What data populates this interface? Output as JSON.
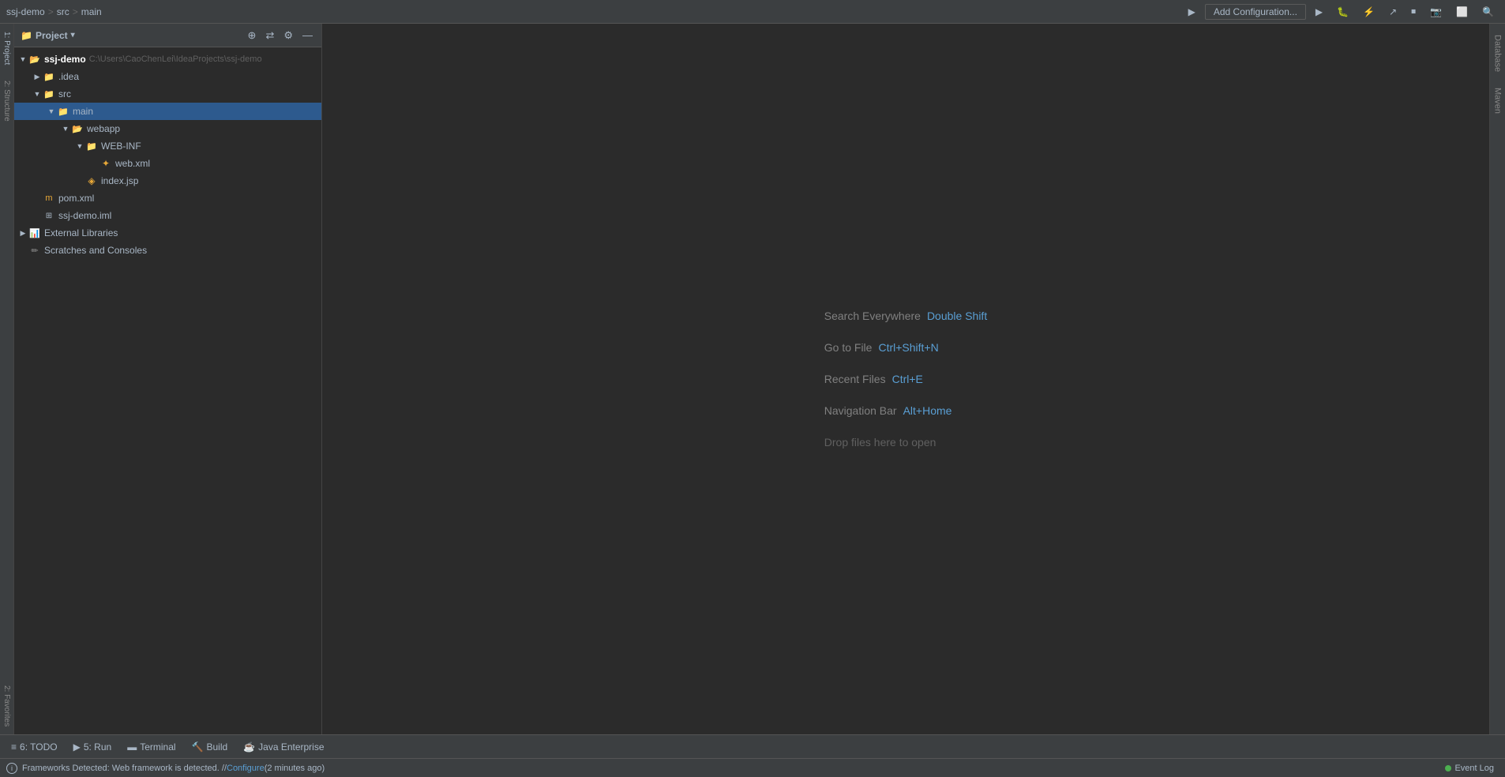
{
  "titlebar": {
    "breadcrumb": [
      "ssj-demo",
      "src",
      "main"
    ],
    "seps": [
      ">",
      ">"
    ],
    "add_config_label": "Add Configuration...",
    "toolbar_buttons": [
      "▶",
      "⏸",
      "🔄",
      "↩",
      "⏹",
      "📷",
      "⬜",
      "🔍"
    ]
  },
  "project_panel": {
    "title": "Project",
    "header_icons": [
      "⊕",
      "⇄",
      "⚙",
      "—"
    ],
    "tree": [
      {
        "id": "ssj-demo-root",
        "label": "ssj-demo",
        "path": "C:\\Users\\CaoChenLei\\IdeaProjects\\ssj-demo",
        "type": "root",
        "indent": 0,
        "arrow": "▼",
        "icon_class": "icon-folder-orange"
      },
      {
        "id": "idea",
        "label": ".idea",
        "type": "folder",
        "indent": 1,
        "arrow": "▶",
        "icon_class": "icon-folder"
      },
      {
        "id": "src",
        "label": "src",
        "type": "src-folder",
        "indent": 1,
        "arrow": "▼",
        "icon_class": "icon-folder-src"
      },
      {
        "id": "main",
        "label": "main",
        "type": "folder",
        "indent": 2,
        "arrow": "▼",
        "icon_class": "icon-folder-blue",
        "selected": true
      },
      {
        "id": "webapp",
        "label": "webapp",
        "type": "folder",
        "indent": 3,
        "arrow": "▼",
        "icon_class": "icon-folder-orange"
      },
      {
        "id": "webinf",
        "label": "WEB-INF",
        "type": "folder",
        "indent": 4,
        "arrow": "▼",
        "icon_class": "icon-folder"
      },
      {
        "id": "webxml",
        "label": "web.xml",
        "type": "xml",
        "indent": 5,
        "arrow": "",
        "icon_class": "icon-file-xml"
      },
      {
        "id": "indexjsp",
        "label": "index.jsp",
        "type": "jsp",
        "indent": 4,
        "arrow": "",
        "icon_class": "icon-file-jsp"
      },
      {
        "id": "pomxml",
        "label": "pom.xml",
        "type": "pom",
        "indent": 0,
        "arrow": "",
        "icon_class": "icon-file-pom"
      },
      {
        "id": "ssj-demo-iml",
        "label": "ssj-demo.iml",
        "type": "iml",
        "indent": 0,
        "arrow": "",
        "icon_class": "icon-file-iml"
      },
      {
        "id": "ext-libs",
        "label": "External Libraries",
        "type": "ext-lib",
        "indent": 0,
        "arrow": "▶",
        "icon_class": "icon-ext-lib"
      },
      {
        "id": "scratches",
        "label": "Scratches and Consoles",
        "type": "scratches",
        "indent": 0,
        "arrow": "",
        "icon_class": "icon-scratches"
      }
    ]
  },
  "editor": {
    "hints": [
      {
        "label": "Search Everywhere",
        "shortcut": "Double Shift"
      },
      {
        "label": "Go to File",
        "shortcut": "Ctrl+Shift+N"
      },
      {
        "label": "Recent Files",
        "shortcut": "Ctrl+E"
      },
      {
        "label": "Navigation Bar",
        "shortcut": "Alt+Home"
      },
      {
        "label": "Drop files here to open",
        "shortcut": ""
      }
    ]
  },
  "bottom_toolbar": {
    "buttons": [
      {
        "icon": "≡",
        "label": "6: TODO"
      },
      {
        "icon": "▶",
        "label": "5: Run"
      },
      {
        "icon": "▬",
        "label": "Terminal"
      },
      {
        "icon": "🔨",
        "label": "Build"
      },
      {
        "icon": "☕",
        "label": "Java Enterprise"
      }
    ]
  },
  "status_bar": {
    "message": "Frameworks Detected: Web framework is detected. // Configure (2 minutes ago)",
    "configure_text": "Configure",
    "event_log_label": "Event Log"
  },
  "right_side_tabs": [
    {
      "label": "Database"
    },
    {
      "label": "Maven"
    }
  ],
  "left_side_tabs": [
    {
      "label": "1: Project"
    },
    {
      "label": "2: Structure"
    },
    {
      "label": "2: Favorites"
    }
  ]
}
